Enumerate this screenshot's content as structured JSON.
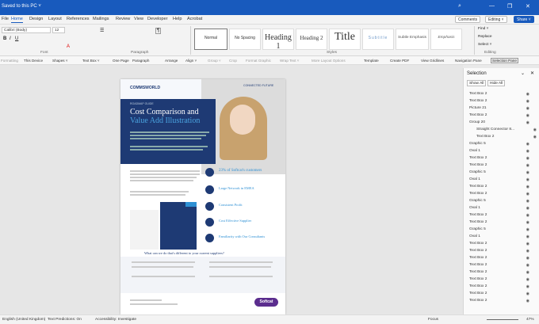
{
  "titlebar": {
    "doc": "Saved to this PC ˅",
    "search_icon": "⌕",
    "min": "—",
    "max": "❐",
    "close": "✕"
  },
  "menu": {
    "items": [
      "File",
      "Home",
      "Design",
      "Layout",
      "References",
      "Mailings",
      "Review",
      "View",
      "Developer",
      "Help",
      "Acrobat"
    ],
    "comments": "Comments",
    "editing": "Editing ˅",
    "share": "Share ˅"
  },
  "ribbon": {
    "font": "Calibri (Body)",
    "size": "12",
    "groups": {
      "font": "Font",
      "paragraph": "Paragraph",
      "styles": "Styles",
      "editing": "Editing"
    },
    "styles": [
      "Normal",
      "No Spacing",
      "Heading 1",
      "Heading 2",
      "Title",
      "Subtitle",
      "Subtle Emphasis",
      "Emphasis"
    ],
    "edit": [
      "Find ˅",
      "Replace",
      "Select ˅"
    ]
  },
  "toolbar2": [
    "Formatting",
    "This Device",
    "Shapes ˅",
    "Text Box ˅",
    "One Page",
    "Paragraph",
    "Arrange",
    "Align ˅",
    "Group ˅",
    "Crop",
    "Format Graphic",
    "Wrap Text ˅",
    "More Layout Options",
    "Template",
    "Create PDF",
    "View Gridlines",
    "Navigation Pane",
    "Selection Pane"
  ],
  "panel": {
    "title": "Selection",
    "show_all": "Show All",
    "hide_all": "Hide All",
    "items": [
      "Text Box 2",
      "Text Box 2",
      "Picture 21",
      "Text Box 2",
      "Group 20",
      "Straight Connector 8...",
      "Text Box 2",
      "Graphic 5",
      "Oval 1",
      "Text Box 2",
      "Text Box 2",
      "Graphic 5",
      "Oval 1",
      "Text Box 2",
      "Text Box 2",
      "Graphic 5",
      "Oval 1",
      "Text Box 2",
      "Text Box 2",
      "Graphic 5",
      "Oval 1",
      "Text Box 2",
      "Text Box 2",
      "Text Box 2",
      "Text Box 2",
      "Text Box 2",
      "Text Box 2",
      "Text Box 2",
      "Text Box 2",
      "Text Box 2"
    ]
  },
  "doc": {
    "brand": "COMMSWORLD",
    "tag": "CONNECTED FUTURE",
    "kicker": "ROADMAP GUIDE",
    "title1": "Cost Comparison and",
    "title2": "Value Add Illustration",
    "footer_logo": "Softcat",
    "mid_title": "What can we do that's different to your current suppliers?",
    "features": [
      "23% of Softcat's customers",
      "Large Network in EMEA",
      "Consistent Profit",
      "Cost Effective Supplier",
      "Familiarity with Our Consultants"
    ]
  },
  "status": {
    "lang": "English (United Kingdom)",
    "pred": "Text Predictions: On",
    "access": "Accessibility: Investigate",
    "focus": "Focus",
    "zoom": "47%"
  }
}
